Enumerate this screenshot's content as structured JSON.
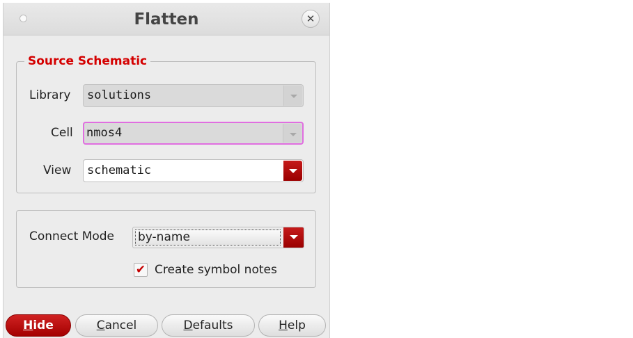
{
  "dialog": {
    "title": "Flatten",
    "close_symbol": "✕"
  },
  "source_schematic": {
    "legend": "Source Schematic",
    "library_label": "Library",
    "library_value": "solutions",
    "cell_label": "Cell",
    "cell_value": "nmos4",
    "view_label": "View",
    "view_value": "schematic"
  },
  "options": {
    "connect_mode_label": "Connect Mode",
    "connect_mode_value": "by-name",
    "create_symbol_notes_label": "Create symbol notes",
    "create_symbol_notes_checked": true,
    "check_symbol": "✔"
  },
  "buttons": {
    "hide_mnemonic": "H",
    "hide_rest": "ide",
    "cancel_mnemonic": "C",
    "cancel_rest": "ancel",
    "defaults_mnemonic": "D",
    "defaults_rest": "efaults",
    "help_mnemonic": "H",
    "help_rest": "elp"
  },
  "colors": {
    "accent_red": "#c40000",
    "focus_magenta": "#e06ee0"
  }
}
